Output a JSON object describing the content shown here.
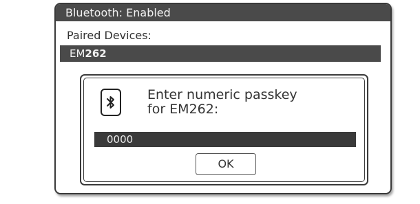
{
  "window": {
    "title": "Bluetooth: Enabled"
  },
  "paired": {
    "label": "Paired Devices:",
    "device_prefix": "EM",
    "device_suffix": "262"
  },
  "dialog": {
    "icon": "bluetooth-icon",
    "prompt_line1": "Enter numeric passkey",
    "prompt_line2": "for EM262:",
    "passkey_value": "0000",
    "ok_label": "OK"
  },
  "colors": {
    "bar_dark": "#4a4a4a",
    "field_dark": "#3a3a3a"
  }
}
